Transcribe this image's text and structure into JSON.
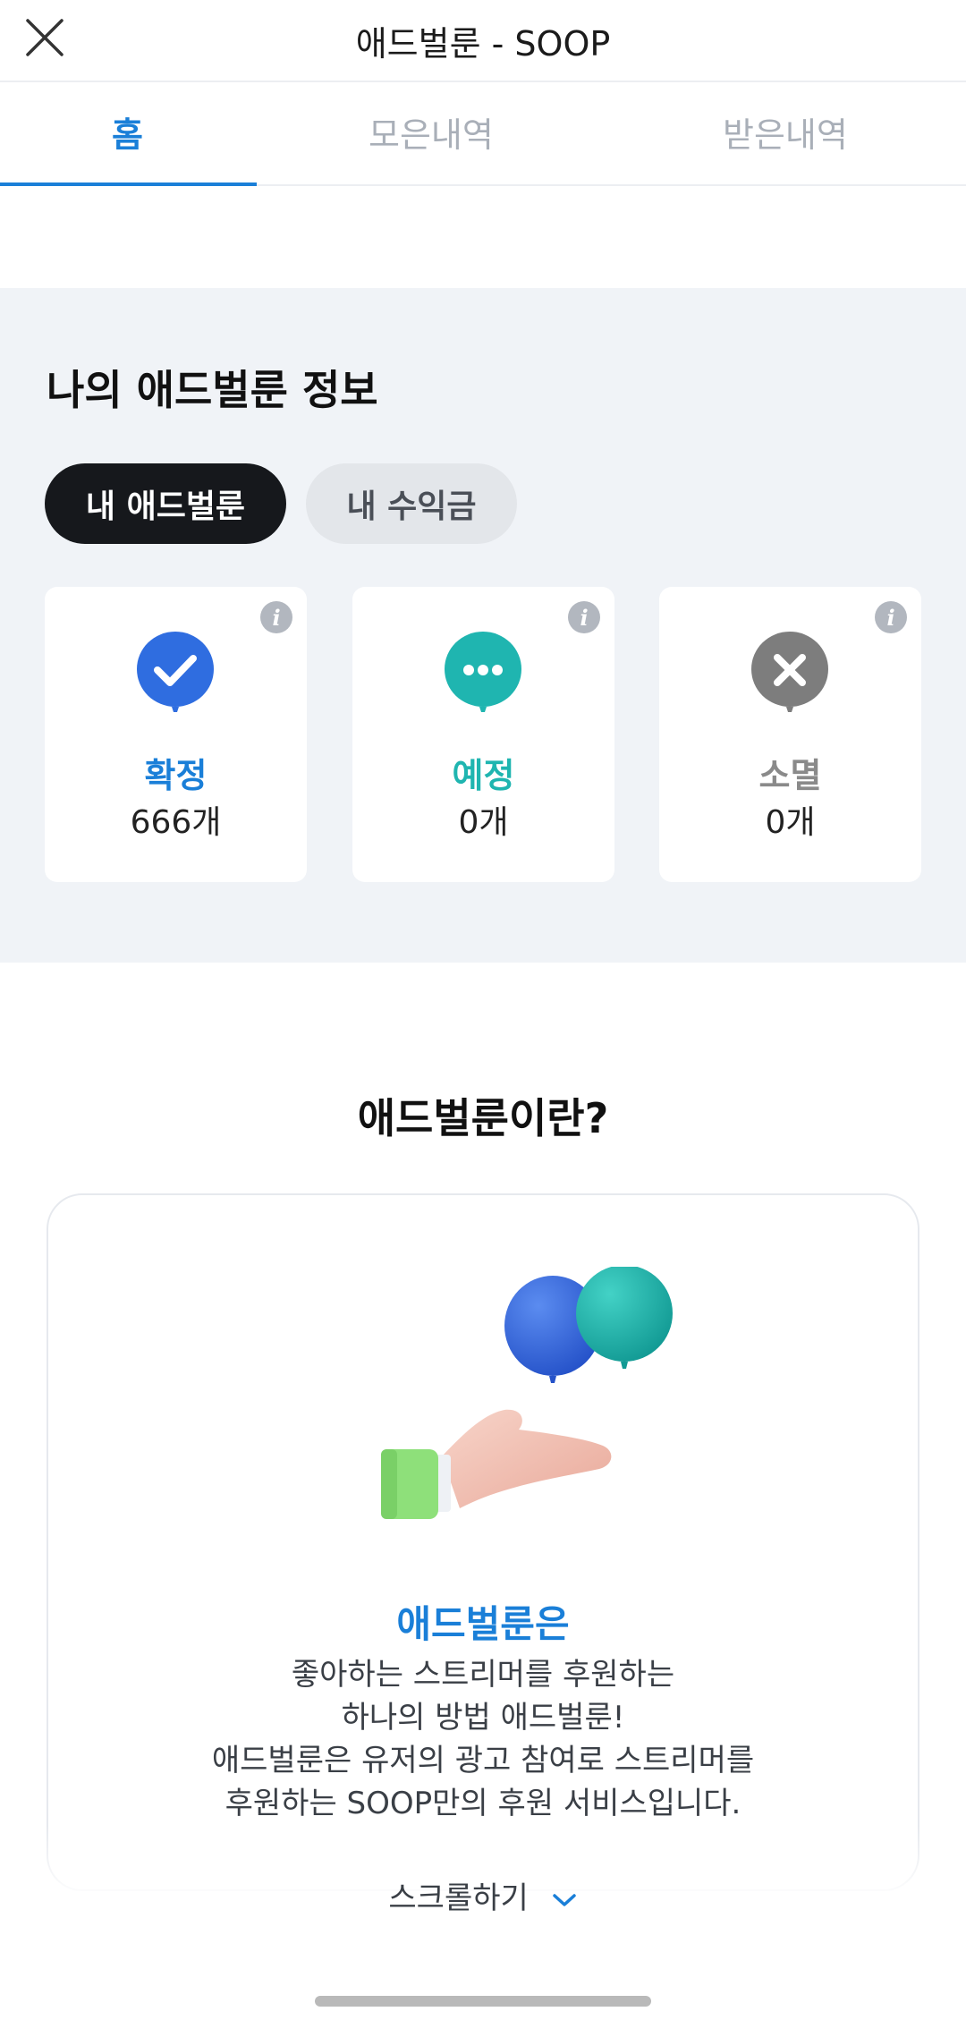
{
  "header": {
    "title": "애드벌룬 - SOOP",
    "close_icon": "close-icon"
  },
  "tabs": [
    {
      "label": "홈",
      "active": true
    },
    {
      "label": "모은내역",
      "active": false
    },
    {
      "label": "받은내역",
      "active": false
    }
  ],
  "info": {
    "title": "나의 애드벌룬 정보",
    "toggle": [
      {
        "label": "내 애드벌룬",
        "active": true
      },
      {
        "label": "내 수익금",
        "active": false
      }
    ],
    "cards": [
      {
        "label": "확정",
        "count": "666개",
        "icon": "check-balloon-icon",
        "color": "#2f6de0",
        "info_icon": "info-icon"
      },
      {
        "label": "예정",
        "count": "0개",
        "icon": "dots-balloon-icon",
        "color": "#1fb5b0",
        "info_icon": "info-icon"
      },
      {
        "label": "소멸",
        "count": "0개",
        "icon": "x-balloon-icon",
        "color": "#8a8a8a",
        "info_icon": "info-icon"
      }
    ]
  },
  "about": {
    "title": "애드벌룬이란?",
    "heading": "애드벌룬은",
    "lines": [
      "좋아하는 스트리머를 후원하는",
      "하나의 방법 애드벌룬!",
      "애드벌룬은 유저의 광고 참여로 스트리머를",
      "후원하는 SOOP만의 후원 서비스입니다."
    ],
    "illustration_icon": "hand-balloons-icon"
  },
  "scroll_hint": {
    "label": "스크롤하기",
    "icon": "chevron-down-icon"
  },
  "colors": {
    "accent": "#1a7fd8",
    "background": "#f0f3f7"
  }
}
